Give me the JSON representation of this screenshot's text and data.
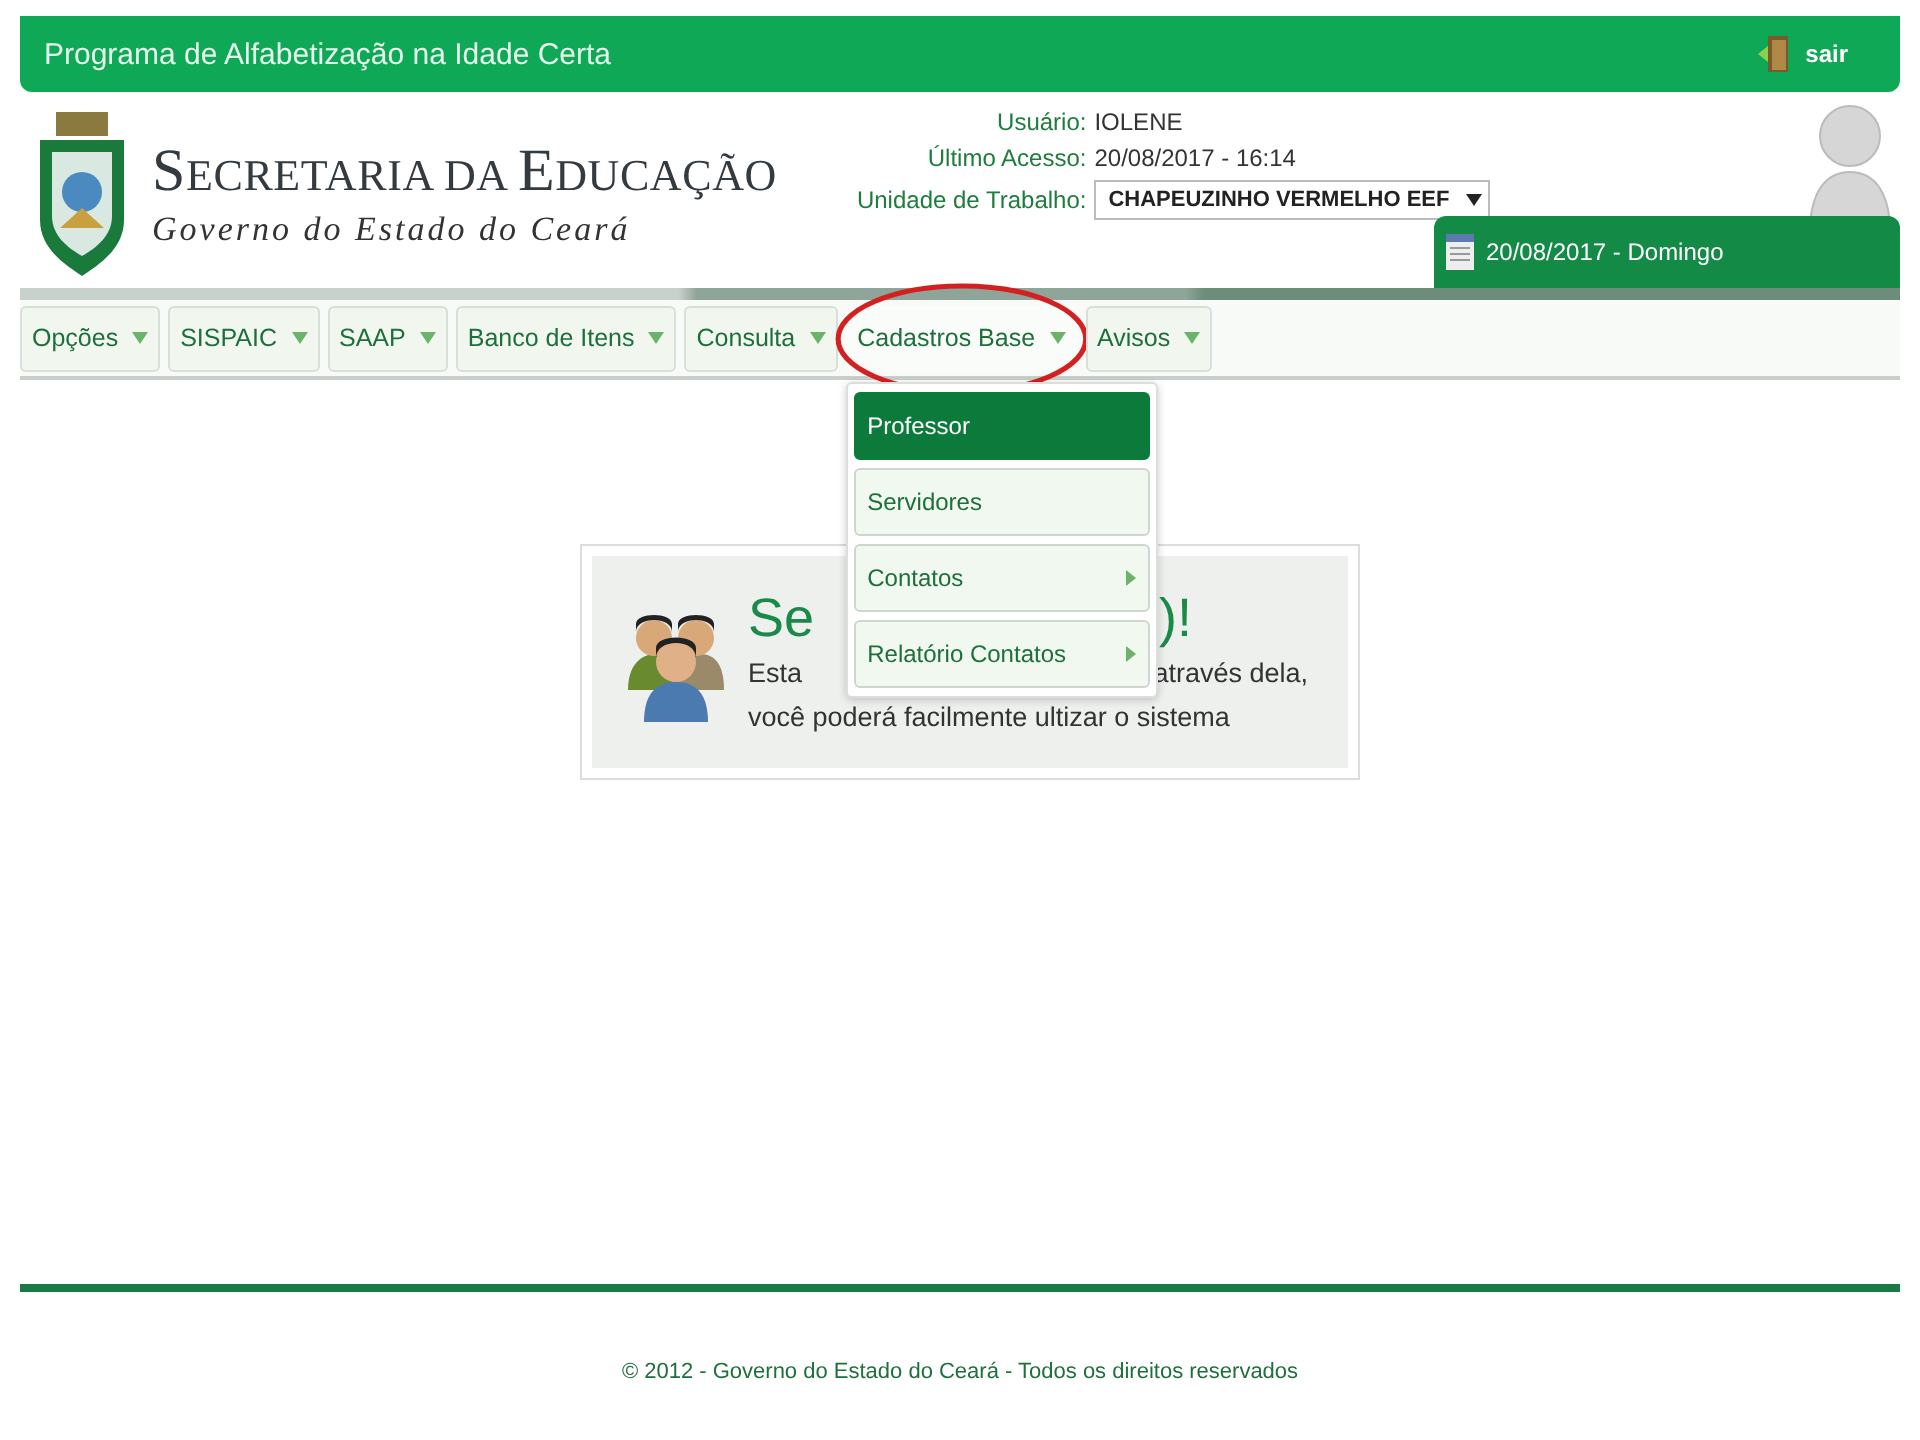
{
  "top_bar": {
    "title": "Programa de Alfabetização na Idade Certa",
    "logout": "sair"
  },
  "brand": {
    "title_parts": [
      "S",
      "ECRETARIA ",
      "DA ",
      "E",
      "DUCAÇÃO"
    ],
    "subtitle": "Governo do Estado do Ceará"
  },
  "user_info": [
    {
      "label": "Usuário:",
      "value": "IOLENE",
      "kind": "text"
    },
    {
      "label": "Último Acesso:",
      "value": "20/08/2017 - 16:14",
      "kind": "text"
    },
    {
      "label": "Unidade de Trabalho:",
      "value": "CHAPEUZINHO VERMELHO EEF",
      "kind": "select"
    }
  ],
  "date_tab": "20/08/2017 - Domingo",
  "menu": [
    {
      "label": "Opções",
      "open": false,
      "circled": false
    },
    {
      "label": "SISPAIC",
      "open": false,
      "circled": false
    },
    {
      "label": "SAAP",
      "open": false,
      "circled": false
    },
    {
      "label": "Banco de Itens",
      "open": false,
      "circled": false
    },
    {
      "label": "Consulta",
      "open": false,
      "circled": false
    },
    {
      "label": "Cadastros Base",
      "open": true,
      "circled": true
    },
    {
      "label": "Avisos",
      "open": false,
      "circled": false
    }
  ],
  "dropdown": [
    {
      "label": "Professor",
      "selected": true,
      "submenu": false
    },
    {
      "label": "Servidores",
      "selected": false,
      "submenu": false
    },
    {
      "label": "Contatos",
      "selected": false,
      "submenu": true
    },
    {
      "label": "Relatório Contatos",
      "selected": false,
      "submenu": true
    }
  ],
  "welcome": {
    "heading_parts": [
      "Se",
      ")!"
    ],
    "line1_parts": [
      "Esta",
      "através dela,"
    ],
    "line2": "você poderá facilmente ultizar o sistema"
  },
  "footer": "© 2012 - Governo do Estado do Ceará - Todos os direitos reservados"
}
